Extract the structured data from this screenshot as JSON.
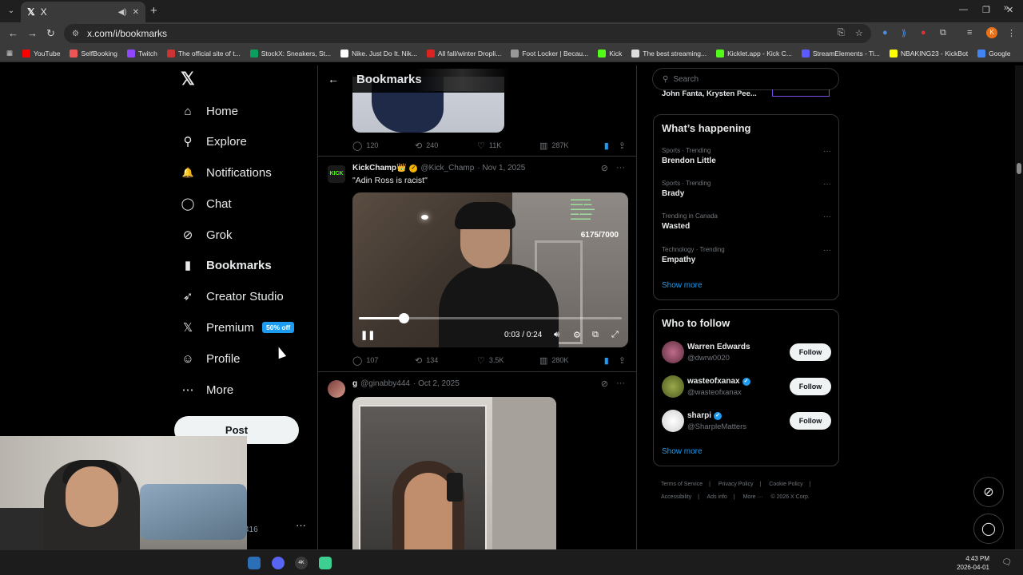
{
  "browser": {
    "tab_title": "X",
    "tab_favicon": "𝕏",
    "url": "x.com/i/bookmarks",
    "bookmarks": [
      {
        "label": "YouTube",
        "color": "#ff0000"
      },
      {
        "label": "SelfBooking",
        "color": "#e55"
      },
      {
        "label": "Twitch",
        "color": "#9146ff"
      },
      {
        "label": "The official site of t...",
        "color": "#c33"
      },
      {
        "label": "StockX: Sneakers, St...",
        "color": "#08a05c"
      },
      {
        "label": "Nike. Just Do It. Nik...",
        "color": "#fff"
      },
      {
        "label": "All fall/winter Dropli...",
        "color": "#d22"
      },
      {
        "label": "Foot Locker | Becau...",
        "color": "#999"
      },
      {
        "label": "Kick",
        "color": "#53fc18"
      },
      {
        "label": "The best streaming...",
        "color": "#ddd"
      },
      {
        "label": "Kicklet.app - Kick C...",
        "color": "#53fc18"
      },
      {
        "label": "StreamElements - Ti...",
        "color": "#5b5bff"
      },
      {
        "label": "NBAKING23 - KickBot",
        "color": "#ff0"
      },
      {
        "label": "Google",
        "color": "#4285f4"
      }
    ]
  },
  "nav": {
    "logo": "𝕏",
    "items": [
      {
        "label": "Home",
        "icon": "⌂"
      },
      {
        "label": "Explore",
        "icon": "⚲"
      },
      {
        "label": "Notifications",
        "icon": "🔔"
      },
      {
        "label": "Chat",
        "icon": "◯"
      },
      {
        "label": "Grok",
        "icon": "⊘"
      },
      {
        "label": "Bookmarks",
        "icon": "▮"
      },
      {
        "label": "Creator Studio",
        "icon": "➶"
      },
      {
        "label": "Premium",
        "icon": "𝕏"
      },
      {
        "label": "Profile",
        "icon": "☺"
      },
      {
        "label": "More",
        "icon": "⋯"
      }
    ],
    "premium_badge": "50% off",
    "post_label": "Post",
    "account_count": "416"
  },
  "center": {
    "header_title": "Bookmarks",
    "post1": {
      "replies": "120",
      "reposts": "240",
      "likes": "11K",
      "views": "287K"
    },
    "post2": {
      "name": "KickChamp👑",
      "handle": "@Kick_Champ",
      "date": "· Nov 1, 2025",
      "text": "\"Adin Ross is racist\"",
      "video_time": "0:03 / 0:24",
      "video_progress": 0.17,
      "sub_counter": "6175/7000",
      "replies": "107",
      "reposts": "134",
      "likes": "3.5K",
      "views": "280K"
    },
    "post3": {
      "name": "g",
      "handle": "@ginabby444",
      "date": "· Oct 2, 2025"
    }
  },
  "right": {
    "search_placeholder": "Search",
    "trend_cut": "John Fanta, Krysten Pee...",
    "whats_happening": {
      "title": "What’s happening",
      "trends": [
        {
          "meta": "Sports · Trending",
          "name": "Brendon Little"
        },
        {
          "meta": "Sports · Trending",
          "name": "Brady"
        },
        {
          "meta": "Trending in Canada",
          "name": "Wasted"
        },
        {
          "meta": "Technology · Trending",
          "name": "Empathy"
        }
      ],
      "show_more": "Show more"
    },
    "who_to_follow": {
      "title": "Who to follow",
      "accounts": [
        {
          "name": "Warren Edwards",
          "handle": "@dwrw0020",
          "verified": false,
          "color": "#8a3b5c"
        },
        {
          "name": "wasteofxanax",
          "handle": "@wasteofxanax",
          "verified": true,
          "color": "#6f8a2e"
        },
        {
          "name": "sharpi",
          "handle": "@SharpleMatters",
          "verified": true,
          "color": "#e9e9e9"
        }
      ],
      "follow_label": "Follow",
      "show_more": "Show more"
    },
    "footer_links": [
      "Terms of Service",
      "|",
      "Privacy Policy",
      "|",
      "Cookie Policy",
      "|",
      "Accessibility",
      "|",
      "Ads info",
      "|",
      "More ···",
      "© 2026 X Corp."
    ]
  },
  "taskbar": {
    "time": "4:43 PM",
    "date": "2026-04-01"
  }
}
